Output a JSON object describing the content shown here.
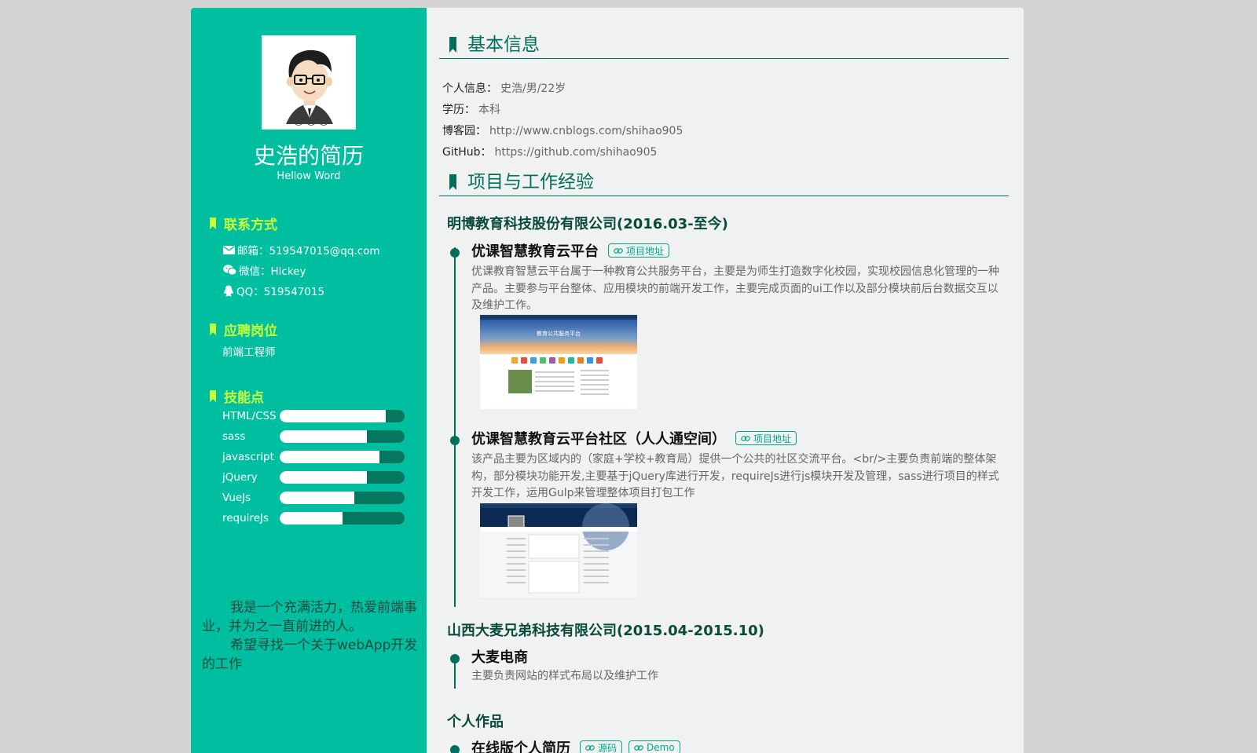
{
  "sidebar": {
    "name": "史浩的简历",
    "motto": "Hellow Word",
    "contact_heading": "联系方式",
    "email": "邮箱：519547015@qq.com",
    "wechat": "微信：Hickey",
    "qq": "QQ：519547015",
    "job_heading": "应聘岗位",
    "job": "前端工程师",
    "skills_heading": "技能点",
    "skills": [
      {
        "name": "HTML/CSS",
        "level": 0.85
      },
      {
        "name": "sass",
        "level": 0.7
      },
      {
        "name": "javascript",
        "level": 0.8
      },
      {
        "name": "jQuery",
        "level": 0.7
      },
      {
        "name": "VueJs",
        "level": 0.6
      },
      {
        "name": "requireJs",
        "level": 0.5
      }
    ],
    "intro_p1": "我是一个充满活力，热爱前端事业，并为之一直前进的人。",
    "intro_p2": "希望寻找一个关于webApp开发的工作",
    "colors": {
      "background": "#00bfa0",
      "accent": "#c6ff3a",
      "bar_track": "#06775f"
    }
  },
  "main": {
    "basic_title": "基本信息",
    "basic": [
      {
        "label": "个人信息：",
        "value": "史浩/男/22岁"
      },
      {
        "label": "学历：",
        "value": "本科"
      },
      {
        "label": "博客园：",
        "value": "http://www.cnblogs.com/shihao905"
      },
      {
        "label": "GitHub：",
        "value": "https://github.com/shihao905"
      }
    ],
    "exp_title": "项目与工作经验",
    "companies": [
      {
        "name": "明博教育科技股份有限公司(2016.03-至今)",
        "projects": [
          {
            "title": "优课智慧教育云平台",
            "tag": "项目地址",
            "desc": "优课教育智慧云平台属于一种教育公共服务平台，主要是为师生打造数字化校园，实现校园信息化管理的一种产品。主要参与平台整体、应用模块的前端开发工作，主要完成页面的ui工作以及部分模块前后台数据交互以及维护工作。",
            "thumb_banner": "教育公共服务平台"
          },
          {
            "title": "优课智慧教育云平台社区（人人通空间）",
            "tag": "项目地址",
            "desc": "该产品主要为区域内的（家庭+学校+教育局）提供一个公共的社区交流平台。<br/>主要负责前端的整体架构，部分模块功能开发,主要基于jQuery库进行开发，requireJs进行js模块开发及管理，sass进行项目的样式开发工作，运用Gulp来管理整体项目打包工作"
          }
        ]
      },
      {
        "name": "山西大麦兄弟科技有限公司(2015.04-2015.10)",
        "projects": [
          {
            "title": "大麦电商",
            "desc": "主要负责网站的样式布局以及维护工作"
          }
        ]
      }
    ],
    "works_title": "个人作品",
    "works": [
      {
        "title": "在线版个人简历",
        "tags": [
          "源码",
          "Demo"
        ]
      }
    ],
    "colors": {
      "background": "#eff2f1",
      "primary": "#046e5c",
      "tag": "#00a88a"
    }
  }
}
